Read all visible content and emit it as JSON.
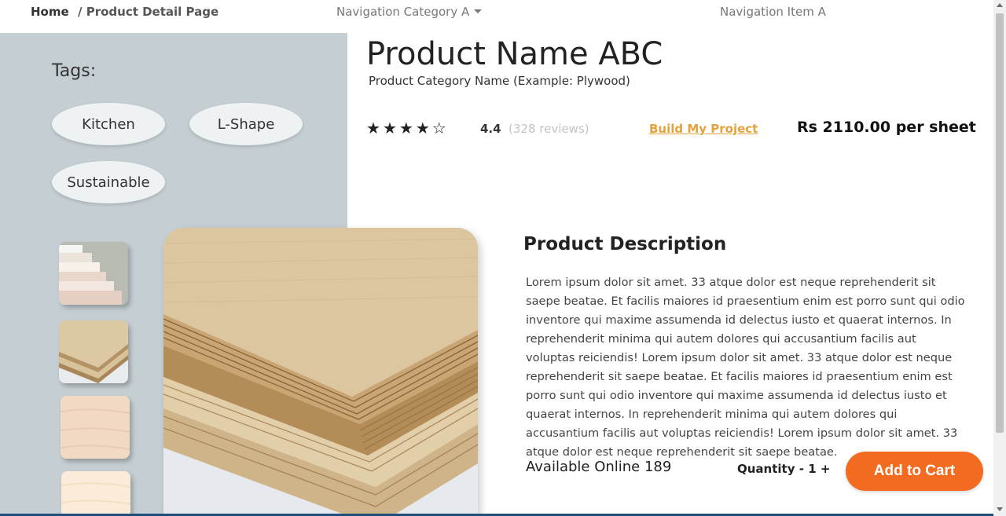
{
  "nav": {
    "breadcrumb_home": "Home",
    "breadcrumb_current": "/ Product Detail Page",
    "category": "Navigation Category A",
    "item": "Navigation Item A"
  },
  "tags": {
    "title": "Tags:",
    "items": [
      "Kitchen",
      "L-Shape",
      "Sustainable"
    ]
  },
  "product": {
    "name": "Product Name ABC",
    "category": "Product Category Name (Example: Plywood)",
    "rating": "4.4",
    "rating_value": 4.4,
    "rating_max": 5,
    "reviews": "(328 reviews)",
    "build_link": "Build My Project ",
    "price": "Rs 2110.00 per sheet",
    "images": [
      "thumbnail-1",
      "thumbnail-2",
      "thumbnail-3",
      "thumbnail-4"
    ]
  },
  "description": {
    "title": "Product Description",
    "text": "Lorem ipsum dolor sit amet. 33 atque dolor est neque reprehenderit sit saepe beatae. Et facilis maiores id praesentium enim est porro sunt qui odio inventore qui maxime assumenda id delectus iusto et quaerat internos. In reprehenderit minima qui autem dolores qui accusantium facilis aut voluptas reiciendis! Lorem ipsum dolor sit amet. 33 atque dolor est neque reprehenderit sit saepe beatae. Et facilis maiores id praesentium enim est porro sunt qui odio inventore qui maxime assumenda id delectus iusto et quaerat internos. In reprehenderit minima qui autem dolores qui accusantium facilis aut voluptas reiciendis! Lorem ipsum dolor sit amet. 33 atque dolor est neque reprehenderit sit saepe beatae."
  },
  "purchase": {
    "available": "Available Online 189",
    "quantity_label": "Quantity -",
    "quantity_minus": "-",
    "quantity_value": "1",
    "quantity_plus": "+",
    "add_to_cart": "Add to Cart"
  },
  "colors": {
    "panel_bg": "#c5cfd3",
    "accent_orange": "#f26b21",
    "link_gold": "#e3a23c"
  },
  "icons": {
    "star_filled": "★",
    "star_empty": "☆"
  }
}
